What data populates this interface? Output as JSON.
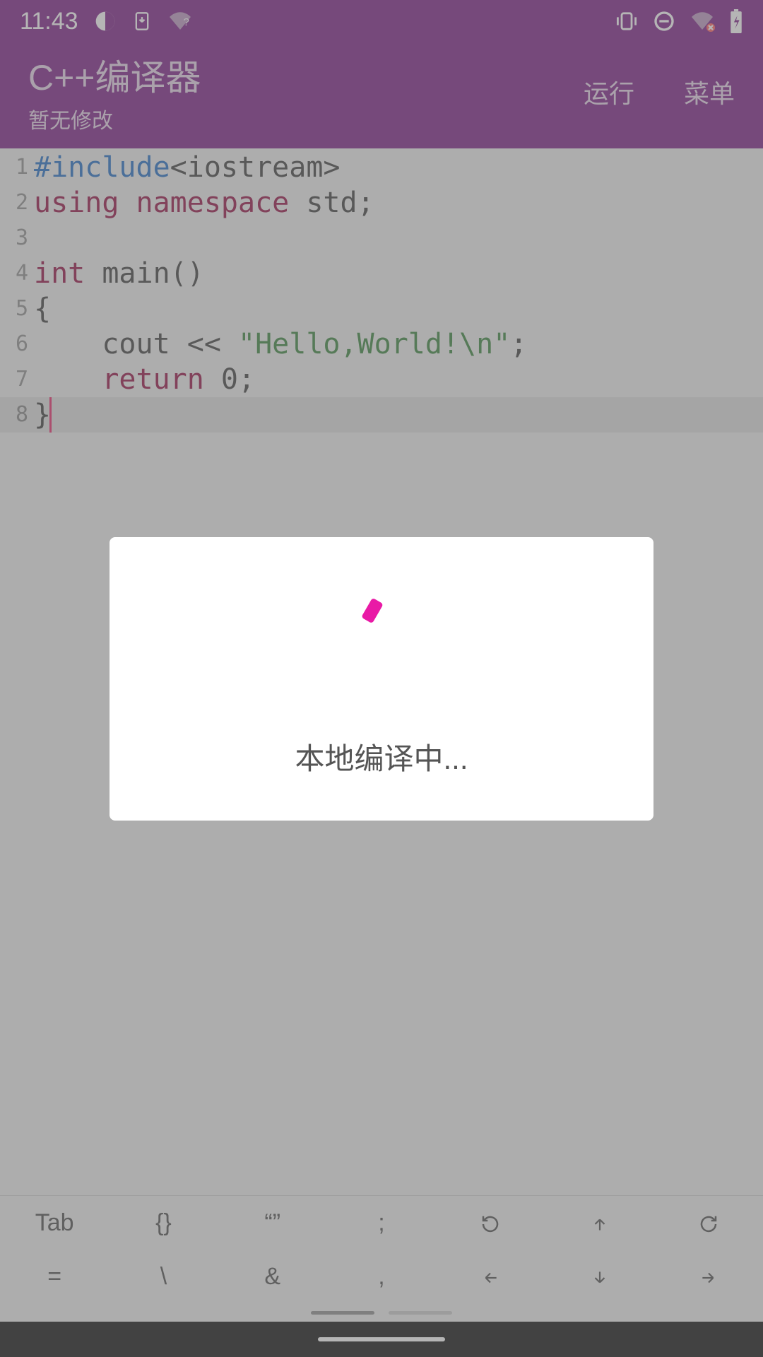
{
  "status": {
    "time": "11:43"
  },
  "header": {
    "title": "C++编译器",
    "subtitle": "暂无修改",
    "run_label": "运行",
    "menu_label": "菜单"
  },
  "code": {
    "lines": [
      {
        "n": "1",
        "segments": [
          {
            "t": "#include",
            "c": "c-pre"
          },
          {
            "t": "<iostream>",
            "c": "c-angle"
          }
        ]
      },
      {
        "n": "2",
        "segments": [
          {
            "t": "using",
            "c": "c-kw"
          },
          {
            "t": " ",
            "c": "c-plain"
          },
          {
            "t": "namespace",
            "c": "c-kw2"
          },
          {
            "t": " std;",
            "c": "c-plain"
          }
        ]
      },
      {
        "n": "3",
        "segments": []
      },
      {
        "n": "4",
        "segments": [
          {
            "t": "int",
            "c": "c-type"
          },
          {
            "t": " main()",
            "c": "c-plain"
          }
        ]
      },
      {
        "n": "5",
        "segments": [
          {
            "t": "{",
            "c": "c-plain"
          }
        ]
      },
      {
        "n": "6",
        "segments": [
          {
            "t": "    cout << ",
            "c": "c-plain"
          },
          {
            "t": "\"Hello,World!\\n\"",
            "c": "c-str"
          },
          {
            "t": ";",
            "c": "c-plain"
          }
        ]
      },
      {
        "n": "7",
        "segments": [
          {
            "t": "    ",
            "c": "c-plain"
          },
          {
            "t": "return",
            "c": "c-kw"
          },
          {
            "t": " 0;",
            "c": "c-plain"
          }
        ]
      },
      {
        "n": "8",
        "segments": [
          {
            "t": "}",
            "c": "c-plain"
          }
        ]
      }
    ],
    "cursor_line": 8
  },
  "shortcuts": {
    "row1": [
      "Tab",
      "{}",
      "“”",
      ";",
      "",
      "",
      "",
      ""
    ],
    "row2": [
      "=",
      "\\",
      "&",
      ",",
      "",
      "",
      "",
      ""
    ]
  },
  "dialog": {
    "text": "本地编译中..."
  }
}
